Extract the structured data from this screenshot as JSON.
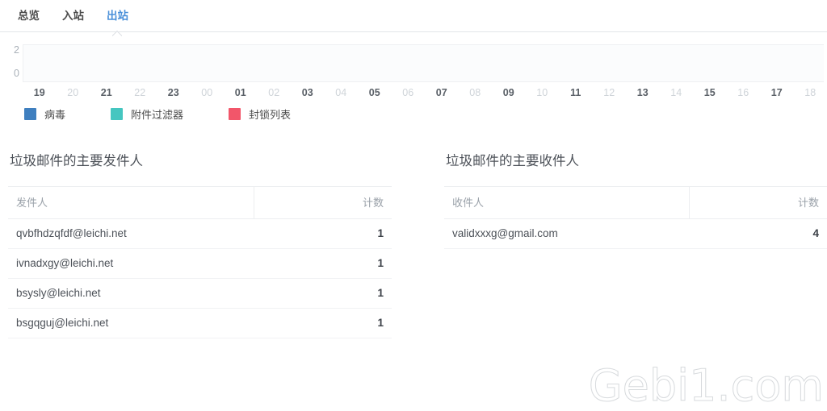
{
  "tabs": [
    {
      "label": "总览",
      "active": false
    },
    {
      "label": "入站",
      "active": false
    },
    {
      "label": "出站",
      "active": true
    }
  ],
  "chart_data": {
    "type": "bar",
    "title": "",
    "xlabel": "",
    "ylabel": "",
    "categories": [
      "19",
      "20",
      "21",
      "22",
      "23",
      "00",
      "01",
      "02",
      "03",
      "04",
      "05",
      "06",
      "07",
      "08",
      "09",
      "10",
      "11",
      "12",
      "13",
      "14",
      "15",
      "16",
      "17",
      "18"
    ],
    "yticks": [
      "2",
      "0"
    ],
    "ylim": [
      0,
      2
    ],
    "grid": false,
    "legend_position": "bottom-left",
    "series": [
      {
        "name": "病毒",
        "color": "#3f7fbf",
        "values": [
          0,
          0,
          0,
          0,
          0,
          0,
          0,
          0,
          0,
          0,
          0,
          0,
          0,
          0,
          0,
          0,
          0,
          0,
          0,
          0,
          0,
          0,
          0,
          0
        ]
      },
      {
        "name": "附件过滤器",
        "color": "#45c6c0",
        "values": [
          0,
          0,
          0,
          0,
          0,
          0,
          0,
          0,
          0,
          0,
          0,
          0,
          0,
          0,
          0,
          0,
          0,
          0,
          0,
          0,
          0,
          0,
          0,
          0
        ]
      },
      {
        "name": "封锁列表",
        "color": "#f2566a",
        "values": [
          0,
          0,
          0,
          0,
          0,
          0,
          0,
          0,
          0,
          0,
          0,
          0,
          0,
          0,
          0,
          0,
          0,
          0,
          0,
          0,
          0,
          0,
          0,
          0
        ]
      }
    ]
  },
  "senders_panel": {
    "title": "垃圾邮件的主要发件人",
    "columns": {
      "name": "发件人",
      "count": "计数"
    },
    "rows": [
      {
        "address": "qvbfhdzqfdf@leichi.net",
        "count": "1"
      },
      {
        "address": "ivnadxgy@leichi.net",
        "count": "1"
      },
      {
        "address": "bsysly@leichi.net",
        "count": "1"
      },
      {
        "address": "bsgqguj@leichi.net",
        "count": "1"
      }
    ]
  },
  "recipients_panel": {
    "title": "垃圾邮件的主要收件人",
    "columns": {
      "name": "收件人",
      "count": "计数"
    },
    "rows": [
      {
        "address": "validxxxg@gmail.com",
        "count": "4"
      }
    ]
  },
  "watermark": {
    "text": "Gebi1.com"
  }
}
